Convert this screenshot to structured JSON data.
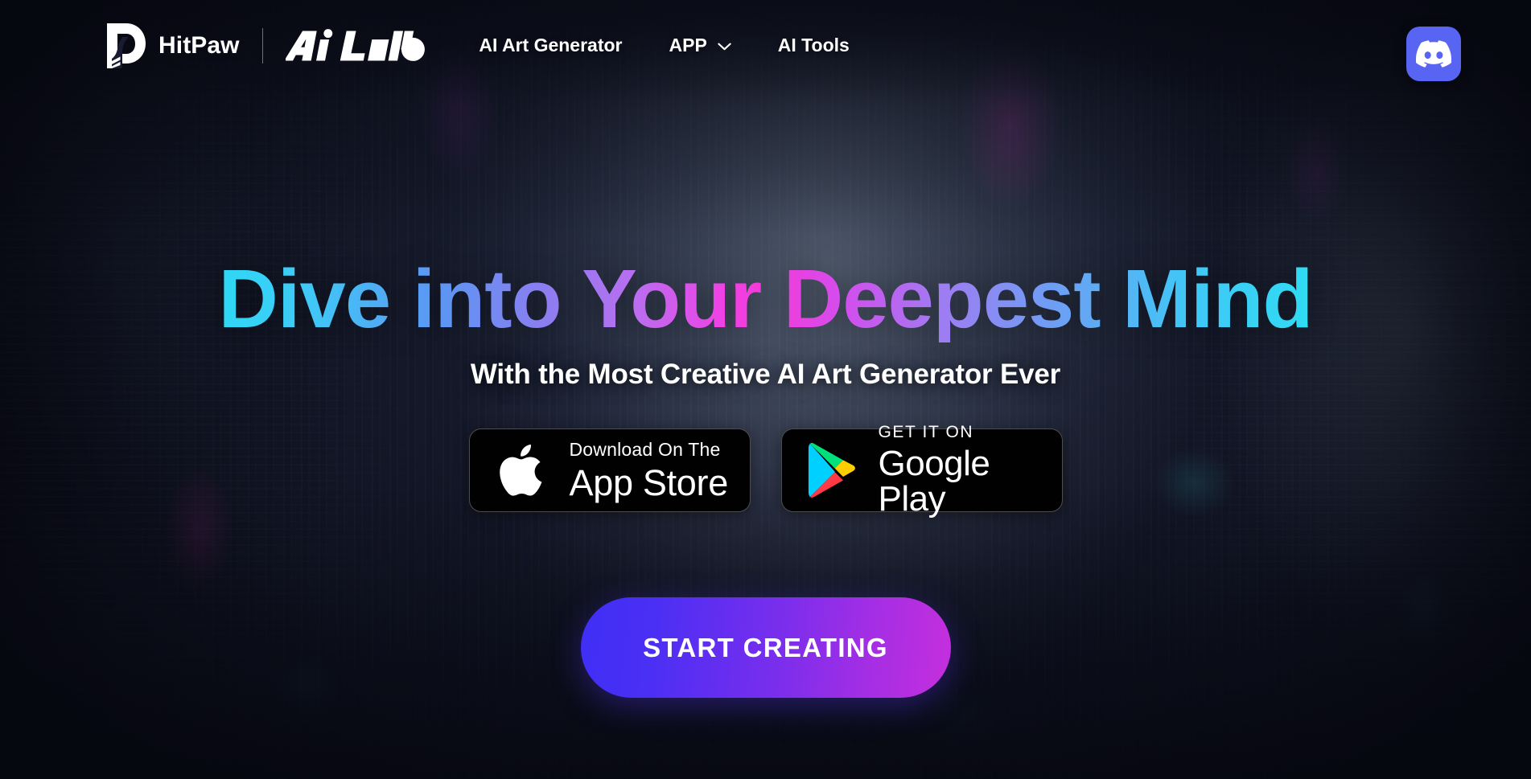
{
  "header": {
    "brand_name": "HitPaw",
    "brand_logo_icon": "hitpaw-paw-logo-icon",
    "sub_brand": "Ai Lab",
    "nav": [
      {
        "label": "AI Art Generator",
        "has_dropdown": false
      },
      {
        "label": "APP",
        "has_dropdown": true,
        "dropdown_icon": "chevron-down-icon"
      },
      {
        "label": "AI Tools",
        "has_dropdown": false
      }
    ],
    "discord": {
      "label": "Discord",
      "icon": "discord-icon",
      "color": "#5865F2"
    }
  },
  "hero": {
    "headline": "Dive into Your Deepest Mind",
    "headline_gradient": [
      "#2FD8F5",
      "#5B96F3",
      "#B96EF0",
      "#F53AD8",
      "#9F7CF2",
      "#42C5F6"
    ],
    "subheadline": "With the Most Creative AI Art Generator Ever",
    "stores": [
      {
        "icon": "apple-icon",
        "small_label": "Download On The",
        "big_label": "App Store"
      },
      {
        "icon": "google-play-icon",
        "small_label": "GET IT ON",
        "big_label": "Google Play"
      }
    ],
    "cta_label": "START CREATING",
    "cta_gradient": [
      "#3F2FF6",
      "#C52FDD"
    ]
  },
  "theme": {
    "background": "#161A2E",
    "text_on_dark": "#FFFFFF",
    "accent_blue": "#5865F2"
  }
}
